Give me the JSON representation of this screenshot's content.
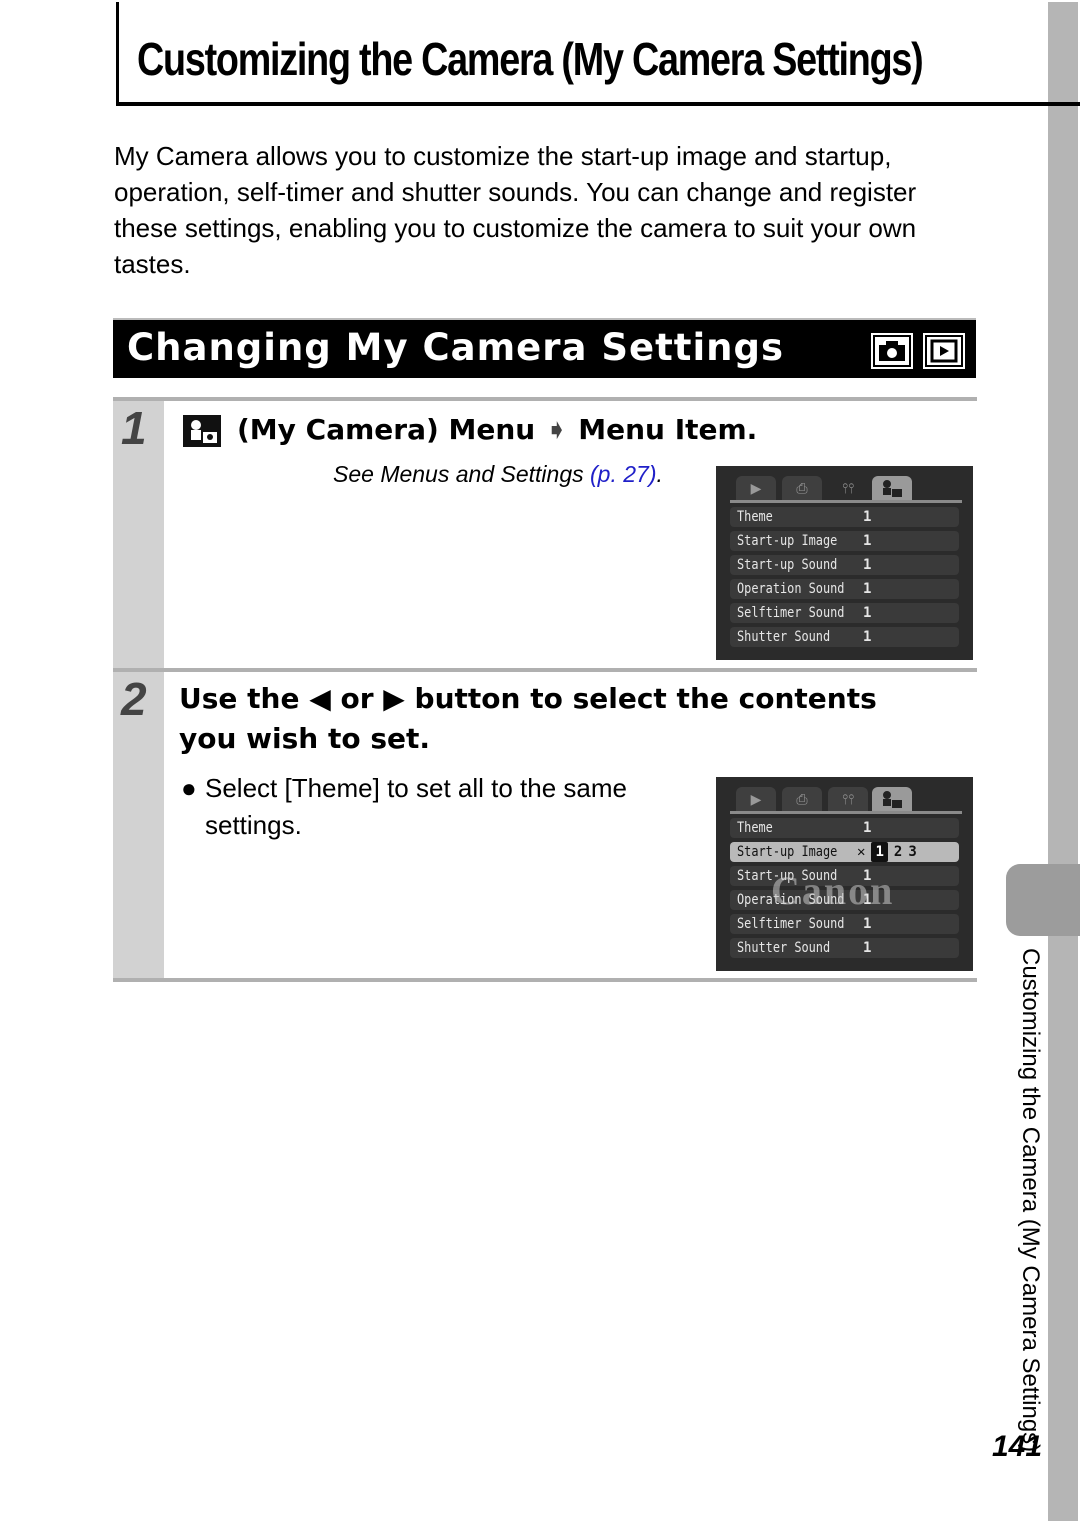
{
  "page": {
    "title": "Customizing the Camera (My Camera Settings)",
    "intro": "My Camera allows you to customize the start-up image and startup, operation, self-timer and shutter sounds. You can change and register these settings, enabling you to customize the camera to suit your own tastes.",
    "side_label": "Customizing the Camera (My Camera Settings)",
    "page_number": "141"
  },
  "section": {
    "title": "Changing My Camera Settings",
    "mode_icons": [
      "camera-icon",
      "playback-icon"
    ]
  },
  "steps": [
    {
      "number": "1",
      "heading_prefix": "(My Camera) Menu",
      "arrow": "➧",
      "heading_suffix": "Menu Item.",
      "reference_text": "See Menus and Settings ",
      "reference_link": "(p. 27)",
      "reference_end": ".",
      "screen": {
        "tabs": [
          "▶",
          "⎙",
          "⫯⫯",
          "My Camera"
        ],
        "active_tab": 3,
        "rows": [
          {
            "label": "Theme",
            "value": "1"
          },
          {
            "label": "Start-up Image",
            "value": "1"
          },
          {
            "label": "Start-up Sound",
            "value": "1"
          },
          {
            "label": "Operation Sound",
            "value": "1"
          },
          {
            "label": "Selftimer Sound",
            "value": "1"
          },
          {
            "label": "Shutter Sound",
            "value": "1"
          }
        ]
      }
    },
    {
      "number": "2",
      "heading_line1": "Use the ◀ or ▶ button to select the contents",
      "heading_line2": "you wish to set.",
      "bullet": "Select [Theme] to set all to the same settings.",
      "screen": {
        "tabs": [
          "▶",
          "⎙",
          "⫯⫯",
          "My Camera"
        ],
        "active_tab": 3,
        "selected_row": 1,
        "selected_options": [
          "✕",
          "1",
          "2",
          "3"
        ],
        "selected_option_active": "1",
        "watermark": "Canon",
        "rows": [
          {
            "label": "Theme",
            "value": "1"
          },
          {
            "label": "Start-up Image",
            "value": "1"
          },
          {
            "label": "Start-up Sound",
            "value": "1"
          },
          {
            "label": "Operation Sound",
            "value": "1"
          },
          {
            "label": "Selftimer Sound",
            "value": "1"
          },
          {
            "label": "Shutter Sound",
            "value": "1"
          }
        ]
      }
    }
  ]
}
